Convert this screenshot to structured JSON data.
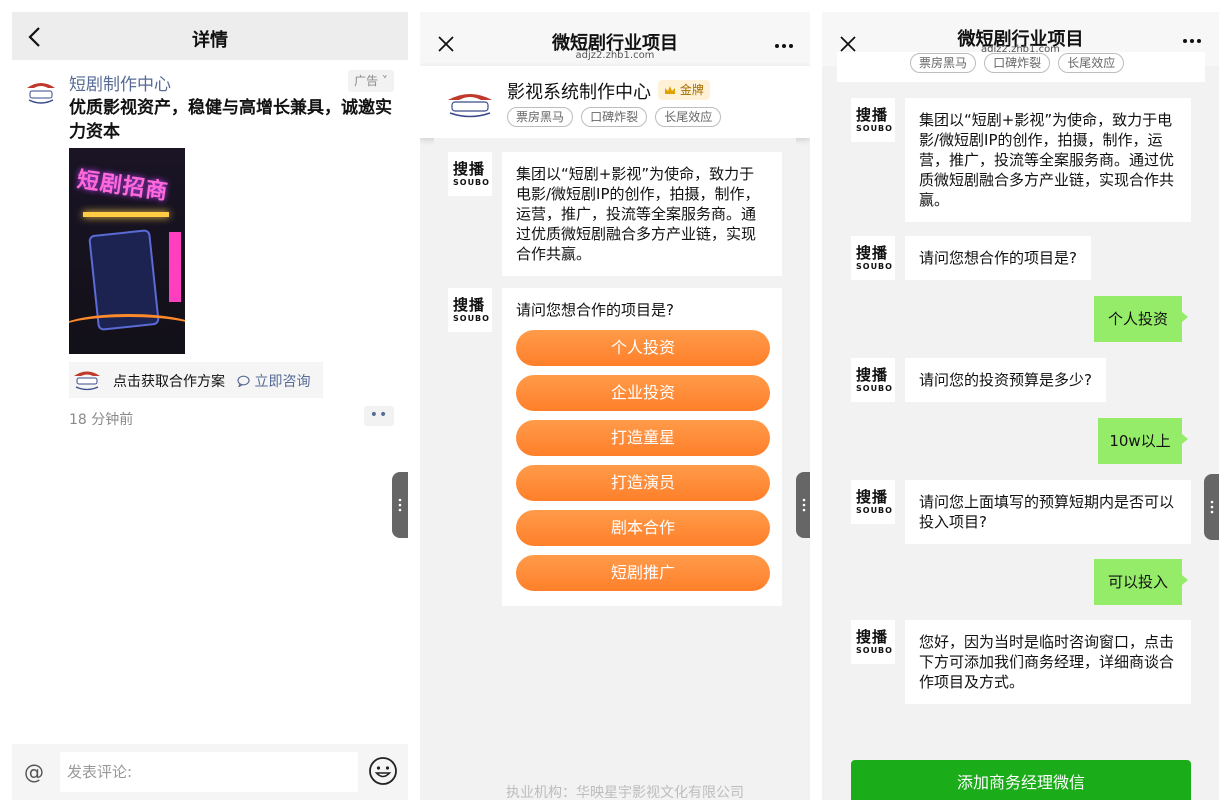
{
  "panel1": {
    "header_title": "详情",
    "ad": {
      "name": "短剧制作中心",
      "tag": "广告",
      "body": "优质影视资产，稳健与高增长兼具，诚邀实力资本",
      "poster_title": "短剧招商",
      "cta_text": "点击获取合作方案",
      "cta_link": "立即咨询",
      "time": "18 分钟前",
      "more": "••"
    },
    "comment_placeholder": "发表评论:"
  },
  "panel2": {
    "title": "微短剧行业项目",
    "subtitle": "adjz2.zhb1.com",
    "brand_name": "影视系统制作中心",
    "gold_badge": "金牌",
    "tags": [
      "票房黑马",
      "口碑炸裂",
      "长尾效应"
    ],
    "intro": "集团以“短剧+影视”为使命，致力于电影/微短剧IP的创作，拍摄，制作，运营，推广，投流等全案服务商。通过优质微短剧融合多方产业链，实现合作共赢。",
    "question": "请问您想合作的项目是?",
    "options": [
      "个人投资",
      "企业投资",
      "打造童星",
      "打造演员",
      "剧本合作",
      "短剧推广"
    ],
    "footer": "执业机构：华映星宇影视文化有限公司"
  },
  "panel3": {
    "title": "微短剧行业项目",
    "subtitle": "adjz2.zhb1.com",
    "tags": [
      "票房黑马",
      "口碑炸裂",
      "长尾效应"
    ],
    "messages": {
      "intro": "集团以“短剧+影视”为使命，致力于电影/微短剧IP的创作，拍摄，制作，运营，推广，投流等全案服务商。通过优质微短剧融合多方产业链，实现合作共赢。",
      "q1": "请问您想合作的项目是?",
      "a1": "个人投资",
      "q2": "请问您的投资预算是多少?",
      "a2": "10w以上",
      "q3": "请问您上面填写的预算短期内是否可以投入项目?",
      "a3": "可以投入",
      "q4": "您好，因为当时是临时咨询窗口，点击下方可添加我们商务经理，详细商谈合作项目及方式。"
    },
    "green_button": "添加商务经理微信"
  },
  "bot_avatar": {
    "line1": "搜播",
    "line2": "SOUBO"
  },
  "colors": {
    "link_blue": "#576b95",
    "orange_start": "#ff9b4a",
    "orange_end": "#ff7f2a",
    "user_bubble": "#95ec69",
    "wechat_green": "#1aad19",
    "chat_bg": "#f2f2f2"
  },
  "icons": [
    "back-arrow-icon",
    "close-icon",
    "more-dots-icon",
    "chat-bubble-icon",
    "at-icon",
    "emoji-icon",
    "crown-icon",
    "drag-handle-icon"
  ]
}
